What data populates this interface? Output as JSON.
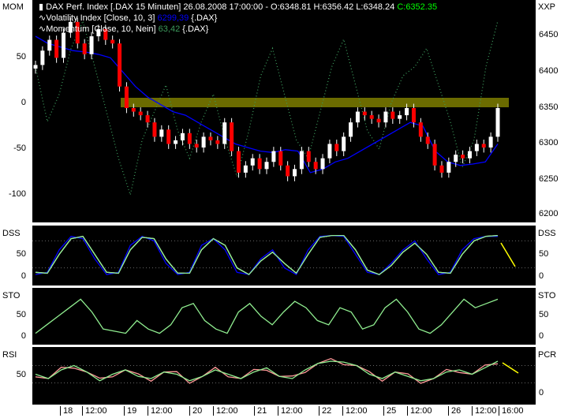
{
  "main": {
    "left_label": "MOM",
    "right_label": "XXP",
    "left_ticks": [
      "50",
      "0",
      "-50",
      "-100"
    ],
    "right_ticks": [
      "6450",
      "6400",
      "6350",
      "6300",
      "6250",
      "6200"
    ],
    "legend": [
      {
        "text": "DAX Perf. Index [.DAX  15 Minuten] 26.08.2008 17:00:00 - O:6348.81 H:6356.42 L:6348.24 ",
        "extra": "C:6352.35",
        "color": "#00ff00",
        "icon": "candle-icon"
      },
      {
        "text": "Volatility Index [Close, 10, 3] ",
        "extra": "6299,39",
        "color": "#0000ff",
        "tail": " {.DAX}",
        "icon": "line-icon"
      },
      {
        "text": "Momentum [Close, 10, Nein] ",
        "extra": "63,42",
        "color": "#3c9a5c",
        "tail": " {.DAX}",
        "icon": "line-icon"
      }
    ]
  },
  "dss": {
    "left_label": "DSS",
    "right_label": "DSS",
    "left_ticks": [
      "50",
      "0"
    ],
    "right_ticks": [
      "50",
      "0"
    ]
  },
  "sto": {
    "left_label": "STO",
    "right_label": "STO",
    "left_ticks": [
      "50",
      "0"
    ],
    "right_ticks": [
      "50",
      "0"
    ]
  },
  "rsi": {
    "left_label": "RSI",
    "right_label": "PCR",
    "left_ticks": [
      "50"
    ],
    "right_ticks": [
      "0"
    ]
  },
  "x_ticks": [
    "18",
    "12:00",
    "19",
    "12:00",
    "20",
    "12:00",
    "21",
    "12:00",
    "22",
    "12:00",
    "25",
    "12:00",
    "26",
    "12:00",
    "16:00"
  ],
  "colors": {
    "up": "#ffffff",
    "down": "#ff0000",
    "vol": "#0000ff",
    "mom": "#3c9a5c",
    "dss1": "#90ee90",
    "dss2": "#0000ff",
    "band": "#6b6b00",
    "arrow": "#ffff00"
  },
  "chart_data": {
    "type": "line",
    "price_closes": [
      6410,
      6430,
      6445,
      6420,
      6455,
      6470,
      6440,
      6425,
      6450,
      6460,
      6445,
      6440,
      6380,
      6350,
      6345,
      6340,
      6330,
      6310,
      6320,
      6300,
      6305,
      6315,
      6300,
      6295,
      6310,
      6305,
      6300,
      6330,
      6290,
      6260,
      6270,
      6280,
      6265,
      6275,
      6290,
      6270,
      6255,
      6265,
      6290,
      6275,
      6265,
      6280,
      6300,
      6290,
      6310,
      6330,
      6345,
      6340,
      6335,
      6330,
      6345,
      6335,
      6340,
      6350,
      6330,
      6310,
      6300,
      6270,
      6260,
      6275,
      6285,
      6280,
      6290,
      6300,
      6295,
      6310,
      6350
    ],
    "volatility": [
      6450,
      6440,
      6435,
      6430,
      6428,
      6425,
      6420,
      6400,
      6380,
      6365,
      6355,
      6345,
      6340,
      6330,
      6320,
      6310,
      6300,
      6295,
      6290,
      6288,
      6292,
      6290,
      6260,
      6265,
      6275,
      6280,
      6290,
      6300,
      6310,
      6320,
      6330,
      6325,
      6290,
      6275,
      6270,
      6272,
      6275,
      6300
    ],
    "momentum": [
      40,
      -20,
      10,
      60,
      90,
      40,
      -10,
      -60,
      -100,
      -40,
      -10,
      20,
      -30,
      -60,
      -20,
      10,
      -40,
      -80,
      -30,
      30,
      60,
      10,
      -40,
      -60,
      -10,
      40,
      70,
      20,
      -30,
      -50,
      0,
      30,
      40,
      60,
      20,
      -20,
      -70,
      -40,
      40,
      90
    ],
    "dss_fast": [
      5,
      10,
      60,
      90,
      85,
      40,
      5,
      10,
      70,
      90,
      80,
      30,
      5,
      10,
      70,
      85,
      60,
      10,
      5,
      40,
      60,
      20,
      5,
      60,
      90,
      92,
      90,
      50,
      10,
      5,
      30,
      60,
      80,
      40,
      5,
      10,
      60,
      85,
      90,
      90
    ],
    "dss_slow": [
      10,
      8,
      50,
      85,
      90,
      50,
      10,
      8,
      60,
      88,
      85,
      40,
      8,
      8,
      60,
      85,
      70,
      20,
      5,
      35,
      55,
      30,
      8,
      50,
      88,
      92,
      92,
      60,
      15,
      5,
      25,
      55,
      75,
      50,
      10,
      8,
      50,
      80,
      90,
      92
    ],
    "sto": [
      10,
      30,
      50,
      70,
      90,
      60,
      20,
      15,
      10,
      40,
      20,
      10,
      30,
      70,
      80,
      40,
      20,
      10,
      60,
      80,
      50,
      30,
      60,
      85,
      70,
      40,
      30,
      70,
      60,
      20,
      30,
      70,
      90,
      60,
      20,
      10,
      30,
      60,
      90,
      70,
      80,
      90
    ],
    "rsi": [
      50,
      40,
      60,
      70,
      55,
      35,
      50,
      60,
      45,
      40,
      55,
      50,
      35,
      45,
      60,
      50,
      40,
      55,
      65,
      45,
      40,
      60,
      75,
      80,
      78,
      70,
      50,
      40,
      55,
      45,
      35,
      40,
      55,
      60,
      50,
      65,
      80
    ]
  }
}
